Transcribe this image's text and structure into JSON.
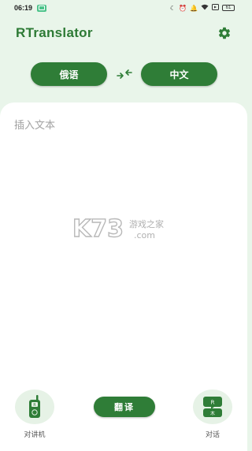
{
  "status_bar": {
    "time": "06:19",
    "battery": "61"
  },
  "app": {
    "title": "RTranslator"
  },
  "languages": {
    "source": "俄语",
    "target": "中文"
  },
  "input": {
    "placeholder": "插入文本",
    "value": ""
  },
  "watermark": {
    "logo": "K73",
    "site_cn": "游戏之家",
    "site_domain": ".com"
  },
  "bottom": {
    "walkie_talkie_label": "对讲机",
    "translate_label": "翻译",
    "conversation_label": "对话"
  },
  "colors": {
    "brand_green": "#2f7d37",
    "title_green": "#2d7a35",
    "header_bg": "#e9f5ea",
    "panel_bg": "#ffffff"
  },
  "icons": {
    "settings": "gear-icon",
    "swap": "swap-arrows-icon",
    "walkie_talkie": "walkie-talkie-icon",
    "conversation": "conversation-icon"
  }
}
